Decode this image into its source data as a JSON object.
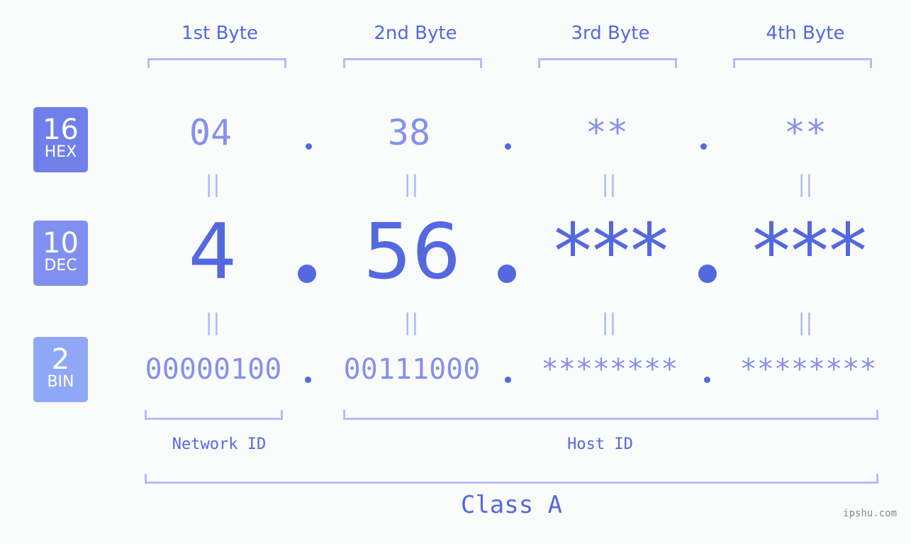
{
  "bytes": {
    "labels": [
      "1st Byte",
      "2nd Byte",
      "3rd Byte",
      "4th Byte"
    ]
  },
  "badges": {
    "hex": {
      "number": "16",
      "label": "HEX",
      "color": "#7080ea"
    },
    "dec": {
      "number": "10",
      "label": "DEC",
      "color": "#8090f0"
    },
    "bin": {
      "number": "2",
      "label": "BIN",
      "color": "#90a8f8"
    }
  },
  "hex_values": [
    "04",
    "38",
    "**",
    "**"
  ],
  "dec_values": [
    "4",
    "56",
    "***",
    "***"
  ],
  "bin_values": [
    "00000100",
    "00111000",
    "********",
    "********"
  ],
  "equals_sign": "||",
  "separator": ".",
  "network_id_label": "Network ID",
  "host_id_label": "Host ID",
  "class_label": "Class A",
  "site": "ipshu.com",
  "colors": {
    "accent": "#5468e0",
    "muted": "#8591ec",
    "bracket": "#b2bdf7",
    "background": "#fafcfb"
  }
}
